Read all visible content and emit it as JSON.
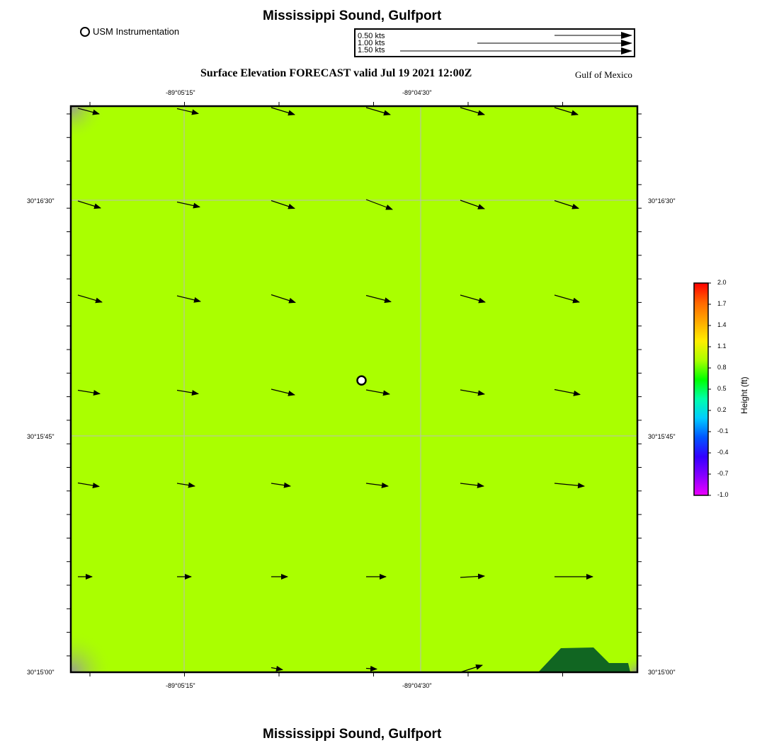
{
  "header": {
    "title": "Mississippi Sound, Gulfport",
    "subtitle": "Surface Elevation FORECAST valid Jul 19 2021 12:00Z",
    "region": "Gulf of Mexico"
  },
  "footer": {
    "title": "Mississippi Sound, Gulfport"
  },
  "legend": {
    "station_label": "USM Instrumentation"
  },
  "vector_key": [
    {
      "label": "0.50 kts",
      "speed": 0.5
    },
    {
      "label": "1.00 kts",
      "speed": 1.0
    },
    {
      "label": "1.50 kts",
      "speed": 1.5
    }
  ],
  "axes": {
    "x_ticks": [
      "-89°05'15\"",
      "-89°04'30\""
    ],
    "y_ticks": [
      "30°16'30\"",
      "30°15'45\"",
      "30°15'00\""
    ]
  },
  "colorbar": {
    "title": "Height (ft)",
    "ticks": [
      "2.0",
      "1.7",
      "1.4",
      "1.1",
      "0.8",
      "0.5",
      "0.2",
      "-0.1",
      "-0.4",
      "-0.7",
      "-1.0"
    ],
    "colors": [
      "#ff0000",
      "#ff6600",
      "#ffaa00",
      "#ffee00",
      "#aaff00",
      "#00ff00",
      "#00ffaa",
      "#00ccff",
      "#0055ff",
      "#3300ff",
      "#8800ff",
      "#ee00ff"
    ]
  },
  "map": {
    "water_color": "#aaff00",
    "land_color": "#116622",
    "station_marker": {
      "col": 3.0,
      "row": 2.85
    }
  },
  "currents": {
    "rows": [
      [
        {
          "dx": 30,
          "dy": 8
        },
        {
          "dx": 30,
          "dy": 7
        },
        {
          "dx": 33,
          "dy": 10
        },
        {
          "dx": 34,
          "dy": 10
        },
        {
          "dx": 34,
          "dy": 10
        },
        {
          "dx": 33,
          "dy": 10
        }
      ],
      [
        {
          "dx": 32,
          "dy": 10
        },
        {
          "dx": 32,
          "dy": 7
        },
        {
          "dx": 33,
          "dy": 11
        },
        {
          "dx": 37,
          "dy": 14
        },
        {
          "dx": 34,
          "dy": 12
        },
        {
          "dx": 34,
          "dy": 11
        }
      ],
      [
        {
          "dx": 34,
          "dy": 10
        },
        {
          "dx": 33,
          "dy": 8
        },
        {
          "dx": 34,
          "dy": 11
        },
        {
          "dx": 35,
          "dy": 9
        },
        {
          "dx": 35,
          "dy": 10
        },
        {
          "dx": 35,
          "dy": 10
        }
      ],
      [
        {
          "dx": 31,
          "dy": 5
        },
        {
          "dx": 30,
          "dy": 5
        },
        {
          "dx": 33,
          "dy": 8
        },
        {
          "dx": 33,
          "dy": 6
        },
        {
          "dx": 34,
          "dy": 6
        },
        {
          "dx": 36,
          "dy": 7
        }
      ],
      [
        {
          "dx": 30,
          "dy": 5
        },
        {
          "dx": 25,
          "dy": 4
        },
        {
          "dx": 27,
          "dy": 4
        },
        {
          "dx": 31,
          "dy": 4
        },
        {
          "dx": 33,
          "dy": 4
        },
        {
          "dx": 42,
          "dy": 4
        }
      ],
      [
        {
          "dx": 20,
          "dy": 0
        },
        {
          "dx": 20,
          "dy": 0
        },
        {
          "dx": 23,
          "dy": 0
        },
        {
          "dx": 28,
          "dy": 0
        },
        {
          "dx": 34,
          "dy": -2
        },
        {
          "dx": 54,
          "dy": 0
        }
      ],
      [
        {
          "dx": 0,
          "dy": 0
        },
        {
          "dx": 0,
          "dy": 0
        },
        {
          "dx": 16,
          "dy": 3
        },
        {
          "dx": 15,
          "dy": 1
        },
        {
          "dx": 31,
          "dy": -10
        },
        {
          "dx": 0,
          "dy": 0
        }
      ]
    ]
  }
}
